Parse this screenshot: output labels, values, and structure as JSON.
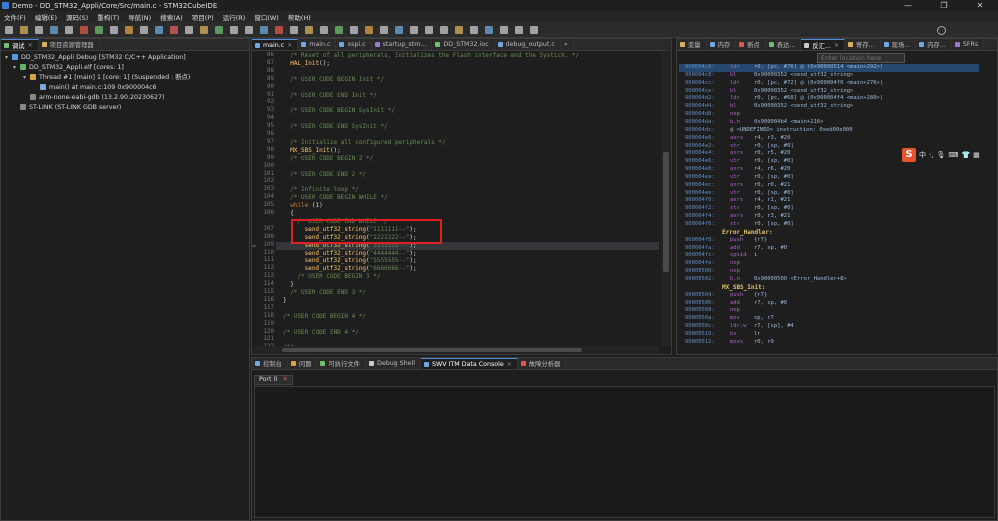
{
  "window": {
    "title": "Demo - DD_STM32_Appli/Core/Src/main.c - STM32CubeIDE",
    "controls": {
      "minimize": "—",
      "maximize": "❐",
      "close": "✕"
    }
  },
  "menu": [
    "文件(F)",
    "编辑(E)",
    "源码(S)",
    "重构(T)",
    "导航(N)",
    "搜索(A)",
    "项目(P)",
    "运行(R)",
    "窗口(W)",
    "帮助(H)"
  ],
  "debug_view": {
    "tabs": [
      {
        "label": "调试",
        "close": "✕"
      },
      {
        "label": "项目资源管理器"
      }
    ],
    "tree": [
      {
        "text": "DD_STM32_Appli Debug [STM32 C/C++ Application]",
        "icon": "debug-config-icon",
        "color": "#4f9de0"
      },
      {
        "text": "DD_STM32_Appli.elf [cores: 1]",
        "icon": "elf-icon",
        "color": "#6bb06b"
      },
      {
        "text": "Thread #1 [main] 1 [core: 1] (Suspended : 断点)",
        "icon": "thread-icon",
        "color": "#d6a640"
      },
      {
        "text": "main() at main.c:109 0x900004c6",
        "icon": "stack-frame-icon",
        "color": "#7aa7e0"
      },
      {
        "text": "arm-none-eabi-gdb (13.2.90.20230627)",
        "icon": "gdb-icon",
        "color": "#888888"
      },
      {
        "text": "ST-LINK (ST-LINK GDB server)",
        "icon": "stlink-icon",
        "color": "#888888"
      }
    ]
  },
  "editor": {
    "tabs": [
      {
        "label": "main.c",
        "close": "✕"
      },
      {
        "label": "main.c"
      },
      {
        "label": "xspi.c"
      },
      {
        "label": "startup_stm..."
      },
      {
        "label": "DD_STM32.ioc"
      },
      {
        "label": "debug_output.c"
      }
    ],
    "overflow": "»",
    "current_line": 109,
    "lines": [
      {
        "n": "86",
        "parts": [
          {
            "t": "/* Reset of all peripherals, Initializes the Flash interface and the Systick. */",
            "c": "comment"
          }
        ],
        "indent": 2
      },
      {
        "n": "87",
        "parts": [
          {
            "t": "HAL_Init",
            "c": "fn"
          },
          {
            "t": "();",
            "c": "plain"
          }
        ],
        "indent": 2
      },
      {
        "n": "88",
        "parts": [],
        "indent": 0
      },
      {
        "n": "89",
        "parts": [
          {
            "t": "/* USER CODE BEGIN Init */",
            "c": "comment"
          }
        ],
        "indent": 2
      },
      {
        "n": "90",
        "parts": [],
        "indent": 0
      },
      {
        "n": "91",
        "parts": [
          {
            "t": "/* USER CODE END Init */",
            "c": "comment"
          }
        ],
        "indent": 2
      },
      {
        "n": "92",
        "parts": [],
        "indent": 0
      },
      {
        "n": "93",
        "parts": [
          {
            "t": "/* USER CODE BEGIN SysInit */",
            "c": "comment"
          }
        ],
        "indent": 2
      },
      {
        "n": "94",
        "parts": [],
        "indent": 0
      },
      {
        "n": "95",
        "parts": [
          {
            "t": "/* USER CODE END SysInit */",
            "c": "comment"
          }
        ],
        "indent": 2
      },
      {
        "n": "96",
        "parts": [],
        "indent": 0
      },
      {
        "n": "97",
        "parts": [
          {
            "t": "/* Initialize all configured peripherals */",
            "c": "comment"
          }
        ],
        "indent": 2
      },
      {
        "n": "98",
        "parts": [
          {
            "t": "MX_SBS_Init",
            "c": "fn"
          },
          {
            "t": "();",
            "c": "plain"
          }
        ],
        "indent": 2
      },
      {
        "n": "99",
        "parts": [
          {
            "t": "/* USER CODE BEGIN 2 */",
            "c": "comment"
          }
        ],
        "indent": 2
      },
      {
        "n": "100",
        "parts": [],
        "indent": 0
      },
      {
        "n": "101",
        "parts": [
          {
            "t": "/* USER CODE END 2 */",
            "c": "comment"
          }
        ],
        "indent": 2
      },
      {
        "n": "102",
        "parts": [],
        "indent": 0
      },
      {
        "n": "103",
        "parts": [
          {
            "t": "/* Infinite loop */",
            "c": "comment"
          }
        ],
        "indent": 2
      },
      {
        "n": "104",
        "parts": [
          {
            "t": "/* USER CODE BEGIN WHILE */",
            "c": "comment"
          }
        ],
        "indent": 2
      },
      {
        "n": "105",
        "parts": [
          {
            "t": "while",
            "c": "kw"
          },
          {
            "t": " (1)",
            "c": "plain"
          }
        ],
        "indent": 2
      },
      {
        "n": "106",
        "parts": [
          {
            "t": "{",
            "c": "plain"
          }
        ],
        "indent": 2
      },
      {
        "n": "",
        "parts": [
          {
            "t": "/* USER CODE END WHILE */",
            "c": "comment"
          }
        ],
        "indent": 4
      },
      {
        "n": "107",
        "parts": [
          {
            "t": "send_utf32_string",
            "c": "fn"
          },
          {
            "t": "(",
            "c": "plain"
          },
          {
            "t": "\"1111111--\"",
            "c": "str"
          },
          {
            "t": ");",
            "c": "plain"
          }
        ],
        "indent": 6
      },
      {
        "n": "108",
        "parts": [
          {
            "t": "send_utf32_string",
            "c": "fn"
          },
          {
            "t": "(",
            "c": "plain"
          },
          {
            "t": "\"2222222--\"",
            "c": "str"
          },
          {
            "t": ");",
            "c": "plain"
          }
        ],
        "indent": 6
      },
      {
        "n": "109",
        "parts": [
          {
            "t": "send_utf32_string",
            "c": "fn"
          },
          {
            "t": "(",
            "c": "plain"
          },
          {
            "t": "\"3333333--\"",
            "c": "str"
          },
          {
            "t": ");",
            "c": "plain"
          }
        ],
        "indent": 6
      },
      {
        "n": "110",
        "parts": [
          {
            "t": "send_utf32_string",
            "c": "fn"
          },
          {
            "t": "(",
            "c": "plain"
          },
          {
            "t": "\"4444444--\"",
            "c": "str"
          },
          {
            "t": ");",
            "c": "plain"
          }
        ],
        "indent": 6
      },
      {
        "n": "111",
        "parts": [
          {
            "t": "send_utf32_string",
            "c": "fn"
          },
          {
            "t": "(",
            "c": "plain"
          },
          {
            "t": "\"5555555--\"",
            "c": "str"
          },
          {
            "t": ");",
            "c": "plain"
          }
        ],
        "indent": 6
      },
      {
        "n": "112",
        "parts": [
          {
            "t": "send_utf32_string",
            "c": "fn"
          },
          {
            "t": "(",
            "c": "plain"
          },
          {
            "t": "\"6666666--\"",
            "c": "str"
          },
          {
            "t": ");",
            "c": "plain"
          }
        ],
        "indent": 6
      },
      {
        "n": "113",
        "parts": [
          {
            "t": "/* USER CODE BEGIN 3 */",
            "c": "comment"
          }
        ],
        "indent": 4
      },
      {
        "n": "114",
        "parts": [
          {
            "t": "}",
            "c": "plain"
          }
        ],
        "indent": 2
      },
      {
        "n": "115",
        "parts": [
          {
            "t": "/* USER CODE END 3 */",
            "c": "comment"
          }
        ],
        "indent": 2
      },
      {
        "n": "116",
        "parts": [
          {
            "t": "}",
            "c": "plain"
          }
        ],
        "indent": 0
      },
      {
        "n": "117",
        "parts": [],
        "indent": 0
      },
      {
        "n": "118",
        "parts": [
          {
            "t": "/* USER CODE BEGIN 4 */",
            "c": "comment"
          }
        ],
        "indent": 0
      },
      {
        "n": "119",
        "parts": [],
        "indent": 0
      },
      {
        "n": "120",
        "parts": [
          {
            "t": "/* USER CODE END 4 */",
            "c": "comment"
          }
        ],
        "indent": 0
      },
      {
        "n": "121",
        "parts": [],
        "indent": 0
      },
      {
        "n": "122",
        "parts": [
          {
            "t": "/**",
            "c": "comment"
          }
        ],
        "indent": 0
      }
    ]
  },
  "disassembly": {
    "tabs": [
      {
        "label": "变量"
      },
      {
        "label": "内存"
      },
      {
        "label": "断点"
      },
      {
        "label": "表达..."
      },
      {
        "label": "反汇...",
        "close": "✕"
      },
      {
        "label": "寄存..."
      },
      {
        "label": "现场..."
      },
      {
        "label": "内存..."
      },
      {
        "label": "SFRs"
      }
    ],
    "location_placeholder": "Enter location here",
    "rows": [
      {
        "type": "ins",
        "addr": "900004c6:",
        "op": "ldr",
        "arg": "r0, [pc, #76]   @ (0x90000514 <main+292>)"
      },
      {
        "type": "ins",
        "addr": "900004c8:",
        "op": "bl",
        "arg": "0x90000352 <send_utf32_string>"
      },
      {
        "type": "ins",
        "addr": "900004cc:",
        "op": "ldr",
        "arg": "r0, [pc, #72]   @ (0x900004f0 <main+276>)"
      },
      {
        "type": "ins",
        "addr": "900004ce:",
        "op": "bl",
        "arg": "0x90000352 <send_utf32_string>"
      },
      {
        "type": "ins",
        "addr": "900004d2:",
        "op": "ldr",
        "arg": "r0, [pc, #68]   @ (0x900004f4 <main+280>)"
      },
      {
        "type": "ins",
        "addr": "900004d4:",
        "op": "bl",
        "arg": "0x90000352 <send_utf32_string>"
      },
      {
        "type": "ins",
        "addr": "900004d8:",
        "op": "nop",
        "arg": ""
      },
      {
        "type": "ins",
        "addr": "900004da:",
        "op": "b.n",
        "arg": "0x900004b4 <main+216>"
      },
      {
        "type": "ins",
        "addr": "900004dc:",
        "op": "",
        "arg": "@ <UNDEFINED> instruction: 0xed00e000"
      },
      {
        "type": "ins",
        "addr": "900004e0:",
        "op": "asrs",
        "arg": "r4, r3, #20"
      },
      {
        "type": "ins",
        "addr": "900004e2:",
        "op": "str",
        "arg": "r0, [sp, #0]"
      },
      {
        "type": "ins",
        "addr": "900004e4:",
        "op": "asrs",
        "arg": "r0, r5, #20"
      },
      {
        "type": "ins",
        "addr": "900004e6:",
        "op": "str",
        "arg": "r0, [sp, #0]"
      },
      {
        "type": "ins",
        "addr": "900004e8:",
        "op": "asrs",
        "arg": "r4, r6, #20"
      },
      {
        "type": "ins",
        "addr": "900004ea:",
        "op": "str",
        "arg": "r0, [sp, #0]"
      },
      {
        "type": "ins",
        "addr": "900004ec:",
        "op": "asrs",
        "arg": "r0, r0, #21"
      },
      {
        "type": "ins",
        "addr": "900004ee:",
        "op": "str",
        "arg": "r0, [sp, #0]"
      },
      {
        "type": "ins",
        "addr": "900004f0:",
        "op": "asrs",
        "arg": "r4, r1, #21"
      },
      {
        "type": "ins",
        "addr": "900004f2:",
        "op": "str",
        "arg": "r0, [sp, #0]"
      },
      {
        "type": "ins",
        "addr": "900004f4:",
        "op": "asrs",
        "arg": "r0, r3, #21"
      },
      {
        "type": "ins",
        "addr": "900004f6:",
        "op": "str",
        "arg": "r0, [sp, #0]"
      },
      {
        "type": "label",
        "text": "Error_Handler:"
      },
      {
        "type": "ins",
        "addr": "900004f8:",
        "op": "push",
        "arg": "{r7}"
      },
      {
        "type": "ins",
        "addr": "900004fa:",
        "op": "add",
        "arg": "r7, sp, #0"
      },
      {
        "type": "ins",
        "addr": "900004fc:",
        "op": "cpsid",
        "arg": "i"
      },
      {
        "type": "ins",
        "addr": "900004fe:",
        "op": "nop",
        "arg": ""
      },
      {
        "type": "ins",
        "addr": "90000500:",
        "op": "nop",
        "arg": ""
      },
      {
        "type": "ins",
        "addr": "90000502:",
        "op": "b.n",
        "arg": "0x90000500 <Error_Handler+8>"
      },
      {
        "type": "label",
        "text": "MX_SBS_Init:"
      },
      {
        "type": "ins",
        "addr": "90000504:",
        "op": "push",
        "arg": "{r7}"
      },
      {
        "type": "ins",
        "addr": "90000506:",
        "op": "add",
        "arg": "r7, sp, #0"
      },
      {
        "type": "ins",
        "addr": "90000508:",
        "op": "nop",
        "arg": ""
      },
      {
        "type": "ins",
        "addr": "9000050a:",
        "op": "mov",
        "arg": "sp, r7"
      },
      {
        "type": "ins",
        "addr": "9000050c:",
        "op": "ldr.w",
        "arg": "r7, [sp], #4"
      },
      {
        "type": "ins",
        "addr": "90000510:",
        "op": "bx",
        "arg": "lr"
      },
      {
        "type": "ins",
        "addr": "90000512:",
        "op": "movs",
        "arg": "r0, r0"
      }
    ]
  },
  "ime": {
    "logo": "S",
    "lang": "中",
    "punct": "·,",
    "mic": "🎙",
    "keyboard": "⌨",
    "shirt": "👕",
    "grid": "▦"
  },
  "console": {
    "tabs": [
      {
        "label": "控制台"
      },
      {
        "label": "问题"
      },
      {
        "label": "可执行文件"
      },
      {
        "label": "Debug Shell"
      },
      {
        "label": "SWV ITM Data Console",
        "close": "✕"
      },
      {
        "label": "故障分析器"
      }
    ],
    "port_tab": "Port 0",
    "port_close": "✕"
  },
  "colors": {
    "accent": "#4e8ee0",
    "highlight_box": "#e02020",
    "current_line": "#34363a",
    "disasm_selection": "#26476e"
  }
}
